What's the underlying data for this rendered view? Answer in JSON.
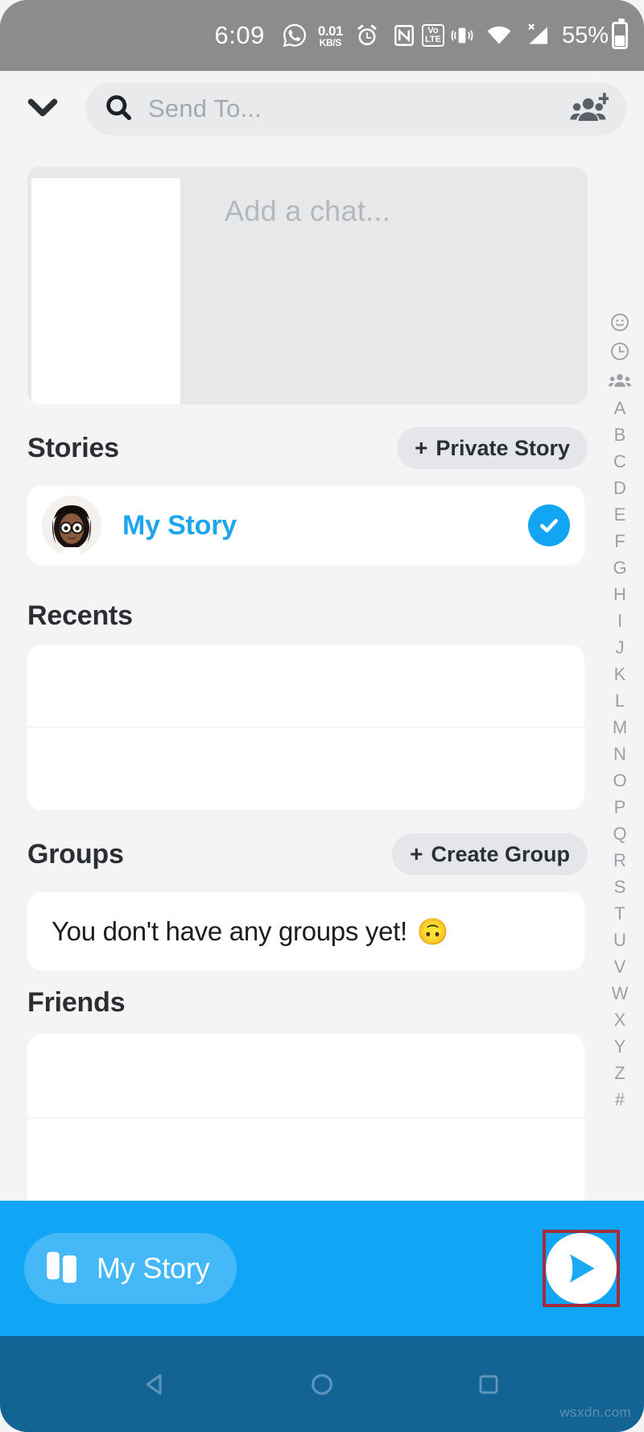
{
  "statusbar": {
    "time": "6:09",
    "whatsapp_icon": "whatsapp-icon",
    "netspeed_value": "0.01",
    "netspeed_unit": "KB/S",
    "alarm_icon": "alarm-clock-icon",
    "nfc_icon": "nfc-icon",
    "volte_top": "Vo",
    "volte_bottom": "LTE",
    "vibrate_icon": "vibrate-icon",
    "wifi_icon": "wifi-icon",
    "signal_icon": "signal-no-sim-icon",
    "battery_percent": "55%"
  },
  "header": {
    "collapse_icon": "chevron-down-icon",
    "search_icon": "search-icon",
    "search_placeholder": "Send To...",
    "search_value": "",
    "add_friends_icon": "add-friends-icon"
  },
  "chat_card": {
    "placeholder": "Add a chat..."
  },
  "sections": {
    "stories": {
      "title": "Stories",
      "action_plus": "+",
      "action_label": "Private Story"
    },
    "recents": {
      "title": "Recents"
    },
    "groups": {
      "title": "Groups",
      "action_plus": "+",
      "action_label": "Create Group",
      "empty_text": "You don't have any groups yet!",
      "empty_emoji": "🙃"
    },
    "friends": {
      "title": "Friends"
    }
  },
  "my_story_row": {
    "avatar_name": "bitmoji-avatar",
    "label": "My Story",
    "selected": true,
    "check_icon": "check-circle-icon"
  },
  "alpha_index": {
    "icons": [
      "emoji-smiley-icon",
      "clock-recent-icon",
      "groups-icon"
    ],
    "letters": [
      "A",
      "B",
      "C",
      "D",
      "E",
      "F",
      "G",
      "H",
      "I",
      "J",
      "K",
      "L",
      "M",
      "N",
      "O",
      "P",
      "Q",
      "R",
      "S",
      "T",
      "U",
      "V",
      "W",
      "X",
      "Y",
      "Z",
      "#"
    ]
  },
  "send_bar": {
    "story_chip_icon": "story-cards-icon",
    "story_chip_label": "My Story",
    "send_icon": "send-arrow-icon",
    "highlighted": true
  },
  "navbar": {
    "back_icon": "nav-back-icon",
    "home_icon": "nav-home-icon",
    "recents_icon": "nav-recents-icon"
  },
  "watermark": "wsxdn.com",
  "colors": {
    "accent_blue": "#11a6f5",
    "story_blue": "#1fa5f0",
    "check_blue": "#12a5f4",
    "statusbar_gray": "#8c8c8c",
    "page_bg": "#f4f4f4",
    "navbar_blue": "#136394",
    "highlight_red": "#a02c3c"
  }
}
